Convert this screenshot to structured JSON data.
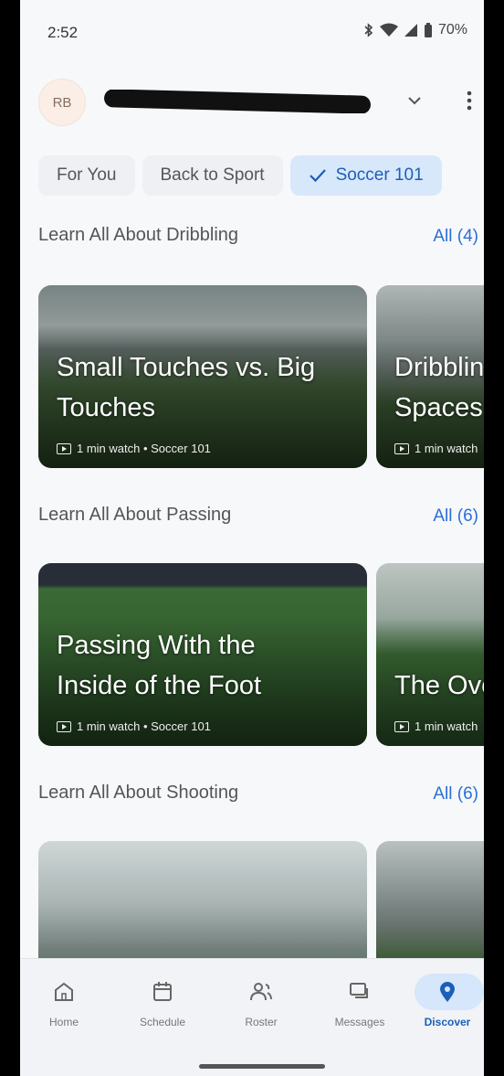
{
  "status_bar": {
    "time": "2:52",
    "battery": "70%"
  },
  "header": {
    "avatar_initials": "RB",
    "team_name_visible_tail": "..."
  },
  "filter_chips": [
    {
      "label": "For You",
      "selected": false
    },
    {
      "label": "Back to Sport",
      "selected": false
    },
    {
      "label": "Soccer 101",
      "selected": true
    }
  ],
  "sections": [
    {
      "title": "Learn All About Dribbling",
      "link": "All (4)",
      "cards": [
        {
          "title": "Small Touches vs. Big\nTouches",
          "meta": "1 min watch • Soccer 101"
        },
        {
          "title": "Dribbling\nSpaces",
          "meta": "1 min watch"
        }
      ]
    },
    {
      "title": "Learn All About Passing",
      "link": "All (6)",
      "cards": [
        {
          "title": "Passing With the\nInside of the Foot",
          "meta": "1 min watch • Soccer 101"
        },
        {
          "title": "The Ove",
          "meta": "1 min watch"
        }
      ]
    },
    {
      "title": "Learn All About Shooting",
      "link": "All (6)",
      "cards": [
        {
          "title": "",
          "meta": ""
        },
        {
          "title": "",
          "meta": ""
        }
      ]
    }
  ],
  "bottom_nav": [
    {
      "label": "Home",
      "icon": "home-icon",
      "active": false
    },
    {
      "label": "Schedule",
      "icon": "calendar-icon",
      "active": false
    },
    {
      "label": "Roster",
      "icon": "people-icon",
      "active": false
    },
    {
      "label": "Messages",
      "icon": "chat-icon",
      "active": false
    },
    {
      "label": "Discover",
      "icon": "location-pin-icon",
      "active": true
    }
  ],
  "colors": {
    "accent": "#2b6fd6",
    "chip_selected_bg": "#d8e8fb",
    "background": "#f7f8fa"
  }
}
